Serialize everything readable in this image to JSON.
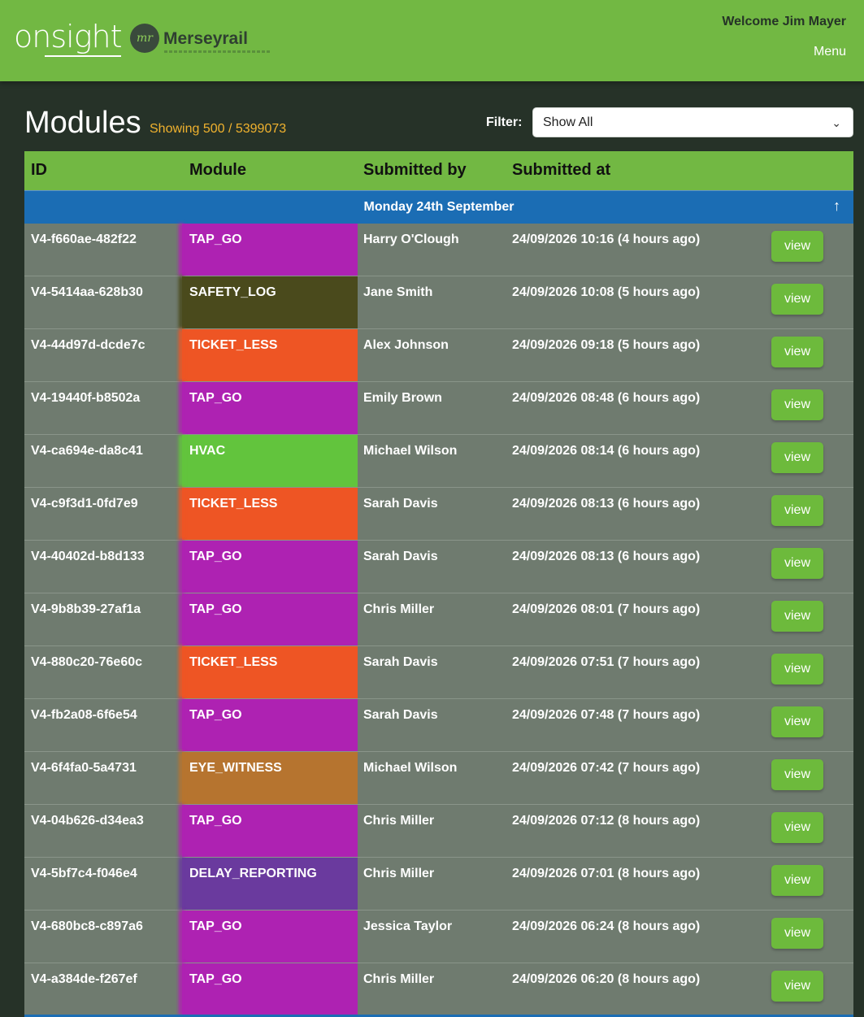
{
  "header": {
    "brand": "onsight",
    "partner_logo_text": "Merseyrail",
    "partner_logo_mark": "mr",
    "welcome": "Welcome Jim Mayer",
    "menu_label": "Menu",
    "bg_color": "#72b843"
  },
  "page": {
    "title": "Modules",
    "showing": "Showing 500 / 5399073",
    "filter_label": "Filter:",
    "filter_value": "Show All"
  },
  "table": {
    "columns": [
      "ID",
      "Module",
      "Submitted by",
      "Submitted at"
    ],
    "group_label": "Monday 24th September",
    "view_label": "view",
    "module_colors": {
      "TAP_GO": "#ae22b2",
      "SAFETY_LOG": "#4a4a1c",
      "TICKET_LESS": "#ee5524",
      "HVAC": "#62c43d",
      "EYE_WITNESS": "#b6742f",
      "DELAY_REPORTING": "#6a3a9e"
    },
    "rows": [
      {
        "id": "V4-f660ae-482f22",
        "module": "TAP_GO",
        "by": "Harry O'Clough",
        "at": "24/09/2026 10:16 (4 hours ago)"
      },
      {
        "id": "V4-5414aa-628b30",
        "module": "SAFETY_LOG",
        "by": "Jane Smith",
        "at": "24/09/2026 10:08 (5 hours ago)"
      },
      {
        "id": "V4-44d97d-dcde7c",
        "module": "TICKET_LESS",
        "by": "Alex Johnson",
        "at": "24/09/2026 09:18 (5 hours ago)"
      },
      {
        "id": "V4-19440f-b8502a",
        "module": "TAP_GO",
        "by": "Emily Brown",
        "at": "24/09/2026 08:48 (6 hours ago)"
      },
      {
        "id": "V4-ca694e-da8c41",
        "module": "HVAC",
        "by": "Michael Wilson",
        "at": "24/09/2026 08:14 (6 hours ago)"
      },
      {
        "id": "V4-c9f3d1-0fd7e9",
        "module": "TICKET_LESS",
        "by": "Sarah Davis",
        "at": "24/09/2026 08:13 (6 hours ago)"
      },
      {
        "id": "V4-40402d-b8d133",
        "module": "TAP_GO",
        "by": "Sarah Davis",
        "at": "24/09/2026 08:13 (6 hours ago)"
      },
      {
        "id": "V4-9b8b39-27af1a",
        "module": "TAP_GO",
        "by": "Chris Miller",
        "at": "24/09/2026 08:01 (7 hours ago)"
      },
      {
        "id": "V4-880c20-76e60c",
        "module": "TICKET_LESS",
        "by": "Sarah Davis",
        "at": "24/09/2026 07:51 (7 hours ago)"
      },
      {
        "id": "V4-fb2a08-6f6e54",
        "module": "TAP_GO",
        "by": "Sarah Davis",
        "at": "24/09/2026 07:48 (7 hours ago)"
      },
      {
        "id": "V4-6f4fa0-5a4731",
        "module": "EYE_WITNESS",
        "by": "Michael Wilson",
        "at": "24/09/2026 07:42 (7 hours ago)"
      },
      {
        "id": "V4-04b626-d34ea3",
        "module": "TAP_GO",
        "by": "Chris Miller",
        "at": "24/09/2026 07:12 (8 hours ago)"
      },
      {
        "id": "V4-5bf7c4-f046e4",
        "module": "DELAY_REPORTING",
        "by": "Chris Miller",
        "at": "24/09/2026 07:01 (8 hours ago)"
      },
      {
        "id": "V4-680bc8-c897a6",
        "module": "TAP_GO",
        "by": "Jessica Taylor",
        "at": "24/09/2026 06:24 (8 hours ago)"
      },
      {
        "id": "V4-a384de-f267ef",
        "module": "TAP_GO",
        "by": "Chris Miller",
        "at": "24/09/2026 06:20 (8 hours ago)"
      }
    ]
  }
}
